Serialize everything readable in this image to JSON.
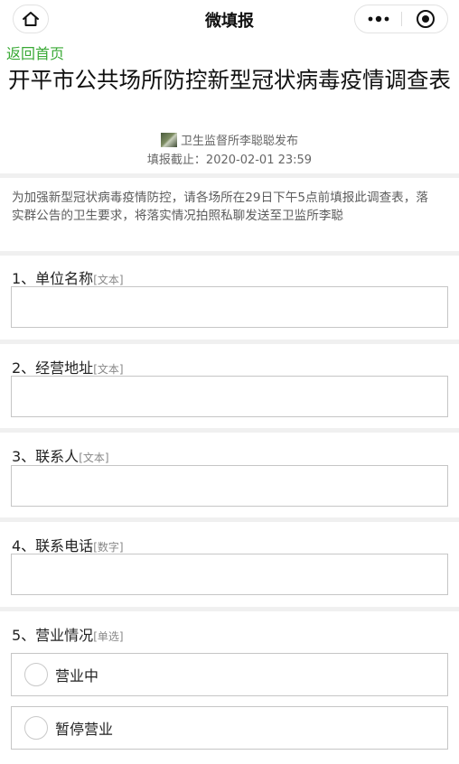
{
  "app": {
    "title": "微填报",
    "home_icon": "home-icon",
    "more_icon": "more-dots-icon",
    "close_icon": "target-close-icon"
  },
  "nav": {
    "back_link": "返回首页"
  },
  "form": {
    "title": "开平市公共场所防控新型冠状病毒疫情调查表",
    "publisher": "卫生监督所李聪聪发布",
    "deadline": "填报截止：2020-02-01 23:59",
    "notice": "为加强新型冠状病毒疫情防控，请各场所在29日下午5点前填报此调查表，落实群公告的卫生要求，将落实情况拍照私聊发送至卫监所李聪"
  },
  "questions": [
    {
      "label": "1、单位名称",
      "type": "[文本]",
      "value": ""
    },
    {
      "label": "2、经营地址",
      "type": "[文本]",
      "value": ""
    },
    {
      "label": "3、联系人",
      "type": "[文本]",
      "value": ""
    },
    {
      "label": "4、联系电话",
      "type": "[数字]",
      "value": ""
    },
    {
      "label": "5、营业情况",
      "type": "[单选]",
      "options": [
        "营业中",
        "暂停营业"
      ]
    }
  ],
  "colors": {
    "link": "#39a935",
    "border": "#c6c6c6",
    "divider": "#f0f0f0"
  }
}
